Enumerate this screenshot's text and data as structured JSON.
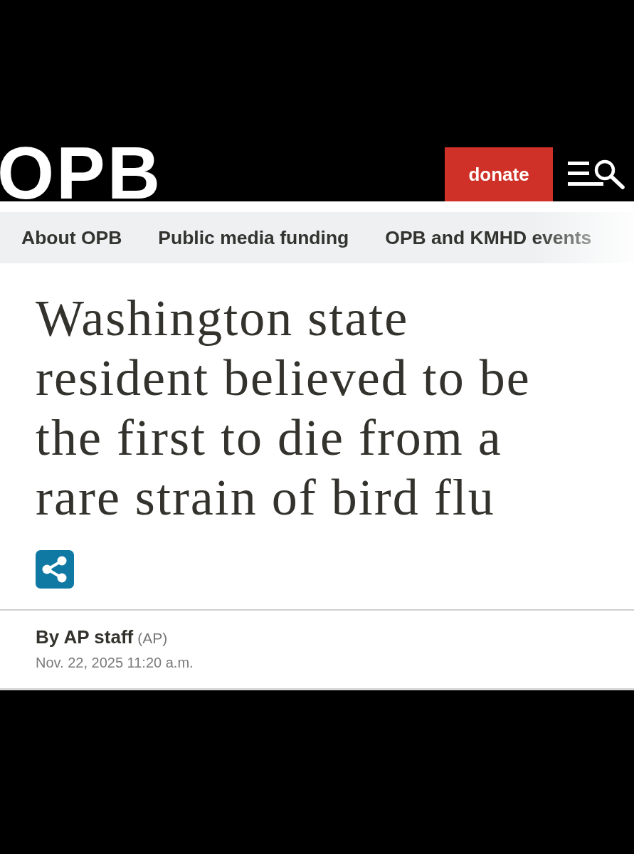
{
  "header": {
    "logo": "OPB",
    "donate_button": "donate"
  },
  "nav": {
    "items": [
      "About OPB",
      "Public media funding",
      "OPB and KMHD events"
    ]
  },
  "article": {
    "headline": "Washington state resident believed to be the first to die from a rare strain of bird flu",
    "byline": {
      "author": "By AP staff",
      "source": "(AP)"
    },
    "date": "Nov. 22, 2025 11:20 a.m."
  }
}
